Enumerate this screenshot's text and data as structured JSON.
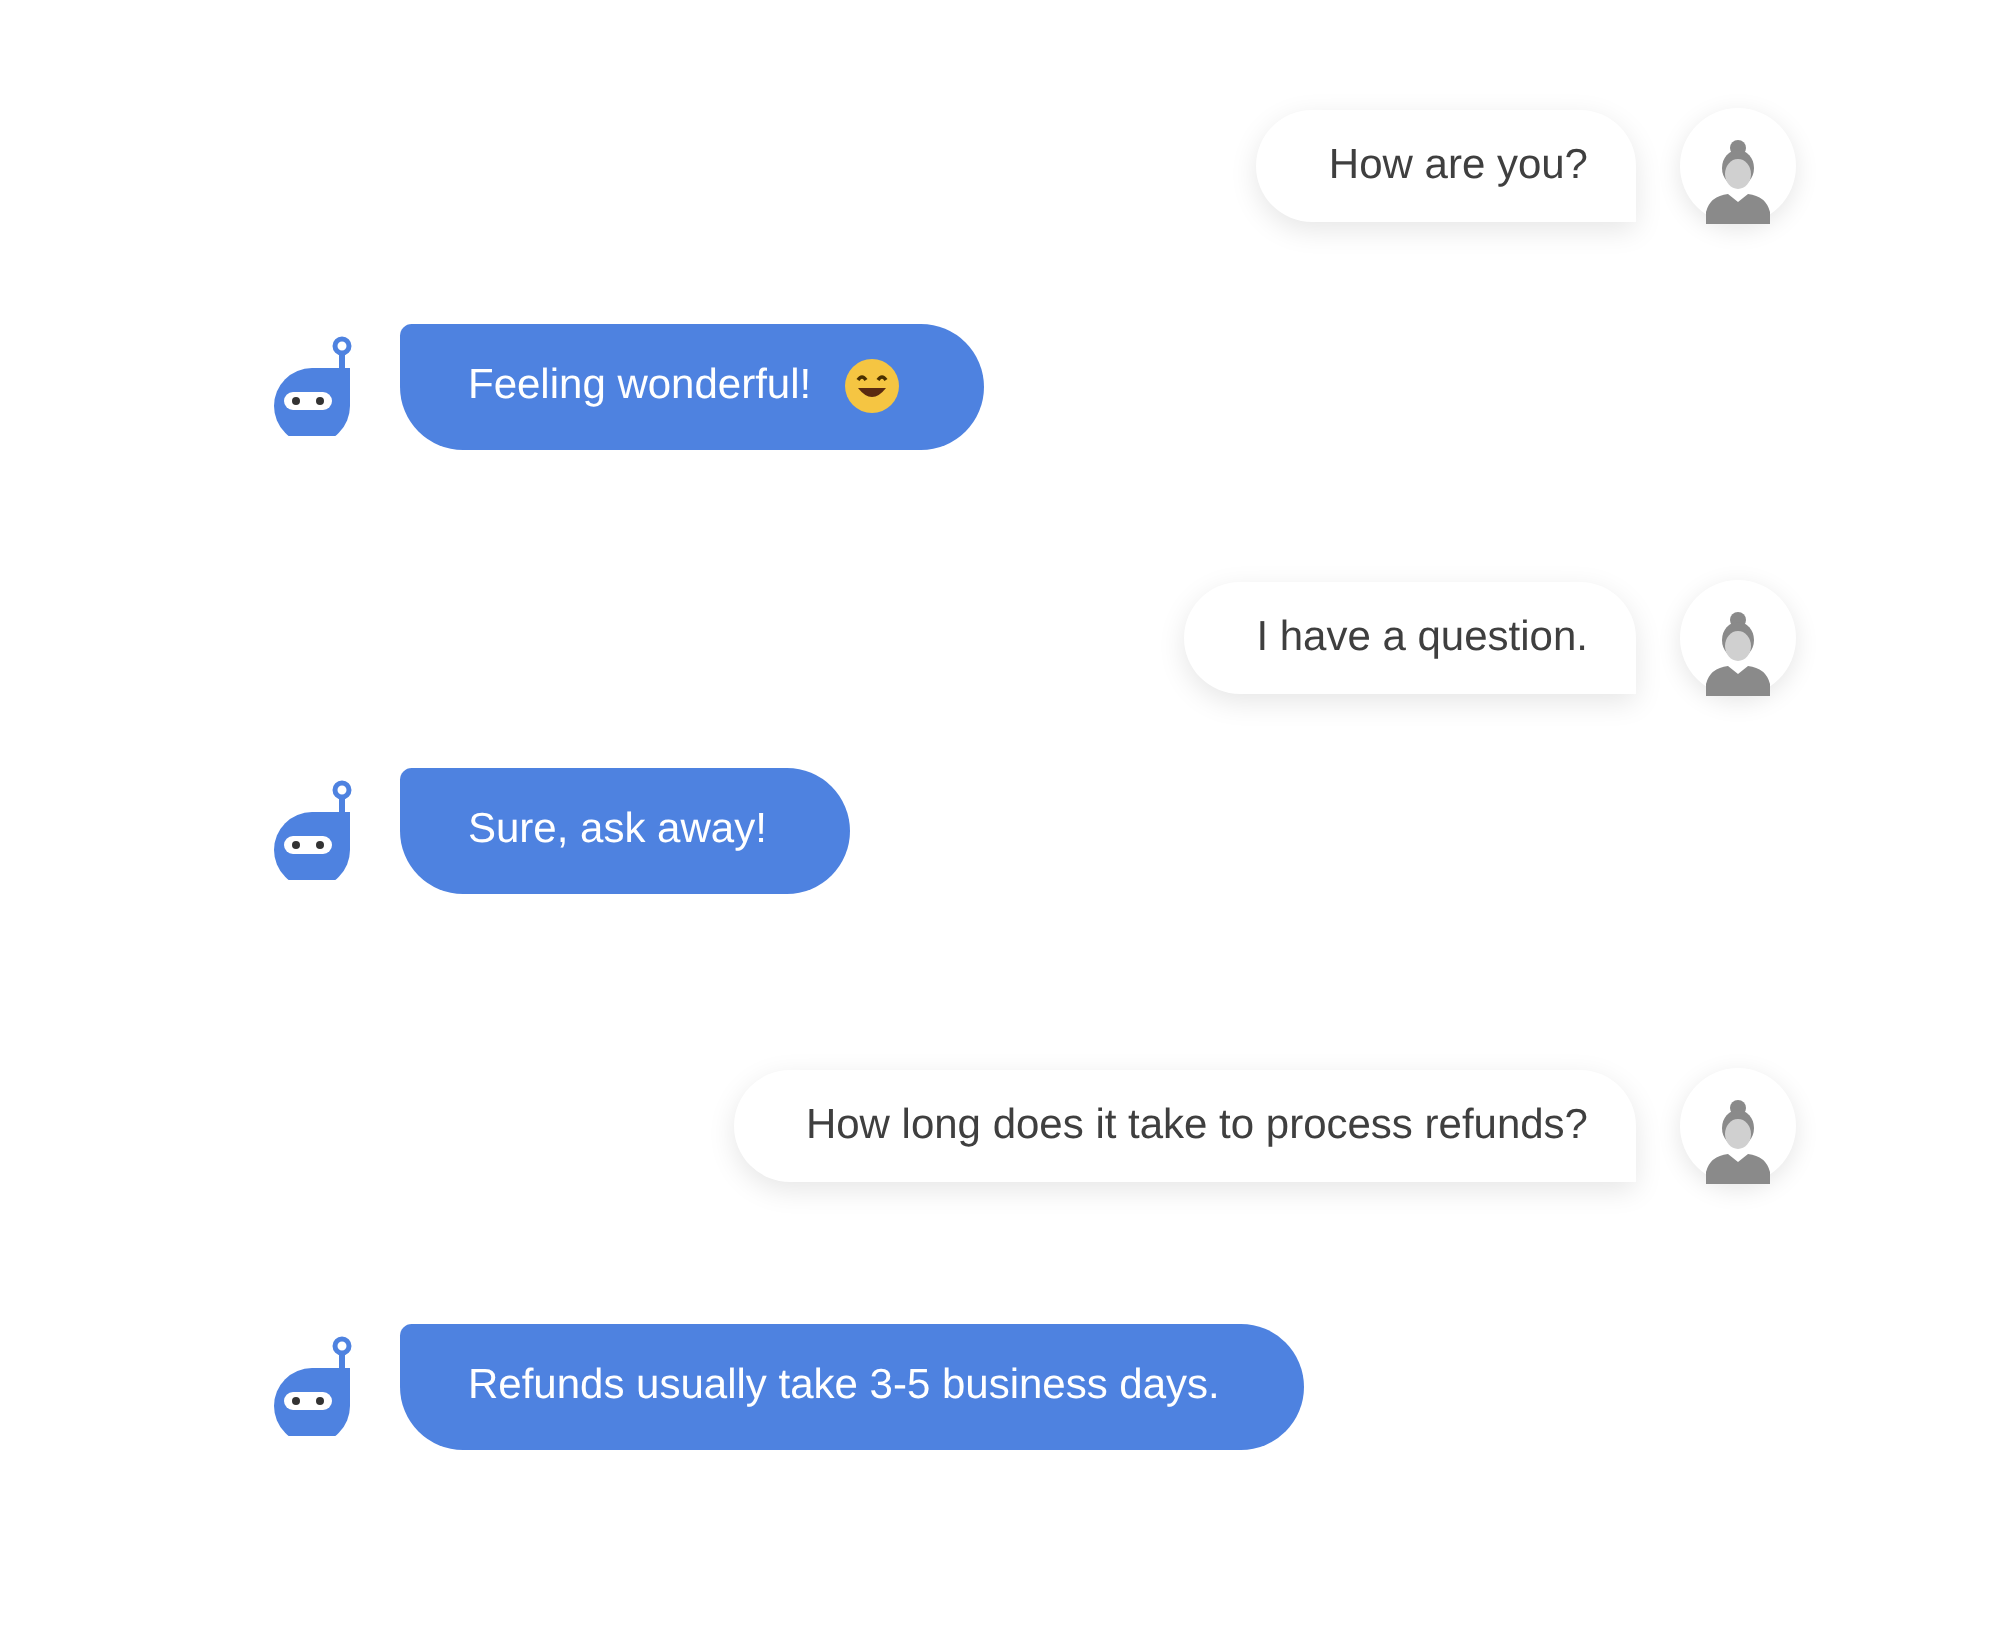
{
  "messages": [
    {
      "kind": "user",
      "text": "How are you?"
    },
    {
      "kind": "bot",
      "text": "Feeling wonderful!",
      "emoji": true
    },
    {
      "kind": "user",
      "text": "I have a question."
    },
    {
      "kind": "bot",
      "text": "Sure, ask away!"
    },
    {
      "kind": "user",
      "text": "How long does it take to process refunds?"
    },
    {
      "kind": "bot",
      "text": "Refunds usually take 3-5 business days."
    }
  ]
}
